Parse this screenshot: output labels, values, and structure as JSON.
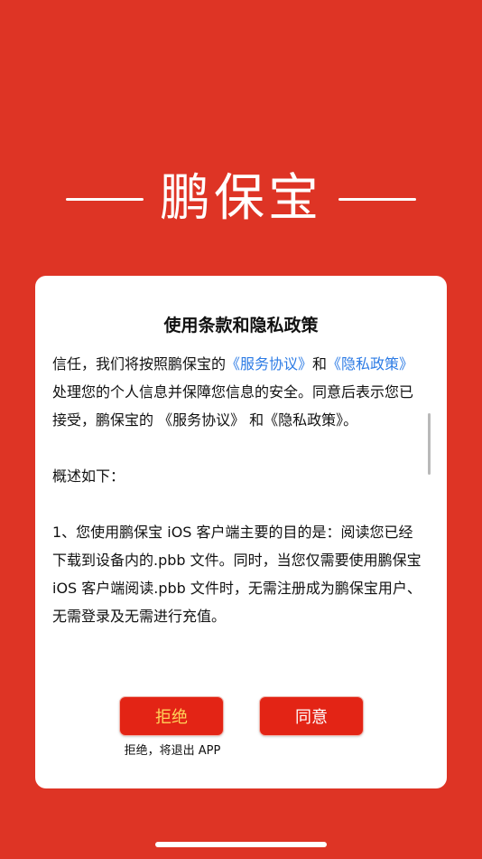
{
  "brand": {
    "title": "鹏保宝"
  },
  "dialog": {
    "title": "使用条款和隐私政策",
    "paragraph1": {
      "text1": "信任，我们将按照鹏保宝的",
      "link1": "《服务协议》",
      "text2": "和",
      "link2": "《隐私政策》",
      "text3": "处理您的个人信息并保障您信息的安全。同意后表示您已接受，鹏保宝的 《服务协议》 和《隐私政策》。"
    },
    "paragraph2": "概述如下：",
    "paragraph3": "1、您使用鹏保宝 iOS 客户端主要的目的是：阅读您已经下载到设备内的.pbb 文件。同时，当您仅需要使用鹏保宝 iOS 客户端阅读.pbb 文件时，无需注册成为鹏保宝用户、无需登录及无需进行充值。",
    "buttons": {
      "reject_label": "拒绝",
      "agree_label": "同意",
      "reject_note": "拒绝，将退出 APP"
    }
  },
  "colors": {
    "background": "#de3425",
    "button": "#e32415",
    "reject_text": "#ffd35a",
    "link": "#2c7be5"
  }
}
